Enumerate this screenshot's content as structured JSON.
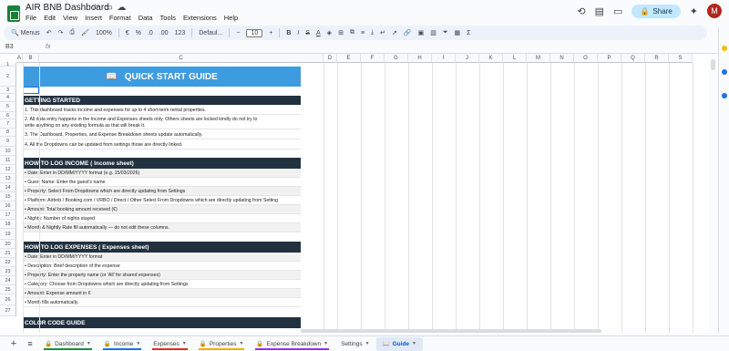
{
  "window": {
    "title": "AIR BNB Dashboard",
    "menus": [
      "File",
      "Edit",
      "View",
      "Insert",
      "Format",
      "Data",
      "Tools",
      "Extensions",
      "Help"
    ],
    "share_label": "Share",
    "avatar_letter": "M"
  },
  "toolbar": {
    "menus_label": "Menus",
    "zoom": "100%",
    "currency": "€",
    "percent": "%",
    "decimal_less": ".0",
    "decimal_more": ".00",
    "number_format": "123",
    "font": "Defaul...",
    "font_size": "10"
  },
  "formula": {
    "cell_ref": "B3",
    "fx": "fx",
    "value": ""
  },
  "columns": [
    "A",
    "B",
    "C",
    "D",
    "E",
    "F",
    "G",
    "H",
    "I",
    "J",
    "K",
    "L",
    "M",
    "N",
    "O",
    "P",
    "Q",
    "R",
    "S"
  ],
  "rows": [
    "1",
    "2",
    "3",
    "4",
    "5",
    "6",
    "7",
    "8",
    "9",
    "10",
    "11",
    "12",
    "13",
    "14",
    "15",
    "16",
    "17",
    "18",
    "19",
    "20",
    "21",
    "22",
    "23",
    "24",
    "25",
    "26",
    "27"
  ],
  "guide": {
    "title": "QUICK START GUIDE",
    "getting_started": {
      "header": "GETTING STARTED",
      "items": [
        "1.  This dashboard tracks income and expenses for up to 4 short-term rental properties.",
        "2.  All data entry happens in the  Income  and  Expenses  sheets only. Others sheets are locked kindly do not try to",
        "write anything on any existing formula as that will break it.",
        "3.  The  Dashboard,  Properties, and  Expense Breakdown sheets update automatically.",
        "4.  All the Dropdowns can be updated from settings those are directly linked."
      ]
    },
    "income": {
      "header": "HOW TO LOG INCOME  (  Income sheet)",
      "items": [
        "•  Date: Enter in DD/MM/YYYY format  (e.g. 15/03/2026)",
        "•  Guest Name: Enter the guest's name",
        "•  Property: Select From Dropdowns which are directly updating from Settings",
        "•  Platform: Airbnb / Booking.com / VRBO / Direct / Other Select From Dropdowns which are directly updating from Setting",
        "•  Amount: Total booking amount received (€)",
        "•  Nights: Number of nights stayed",
        "•  Month & Nightly Rate fill automatically — do not edit these columns."
      ]
    },
    "expenses": {
      "header": "HOW TO LOG EXPENSES  (  Expenses sheet)",
      "items": [
        "•  Date: Enter in DD/MM/YYYY format",
        "•  Description: Brief description of the expense",
        "•  Property: Enter the property name (or 'All' for shared expenses)",
        "•  Category: Choose from Dropdowns which are directly updating from Settings",
        "•  Amount: Expense amount in €",
        "•  Month fills automatically."
      ]
    },
    "color_code": {
      "header": "COLOR CODE GUIDE"
    }
  },
  "tabs": [
    {
      "label": "Dashboard",
      "color": "#1e8e3e",
      "locked": true
    },
    {
      "label": "Income",
      "color": "#1a73e8",
      "locked": true
    },
    {
      "label": "Expenses",
      "color": "#d93025",
      "locked": false
    },
    {
      "label": "Properties",
      "color": "#f9ab00",
      "locked": true
    },
    {
      "label": "Expense Breakdown",
      "color": "#9334e6",
      "locked": true
    },
    {
      "label": "Settings",
      "color": "",
      "locked": false
    },
    {
      "label": "Guide",
      "color": "",
      "locked": false,
      "active": true
    }
  ],
  "colors": {
    "title_bg": "#3d9be0",
    "header_bg": "#22313f",
    "accent": "#0b57d0"
  }
}
